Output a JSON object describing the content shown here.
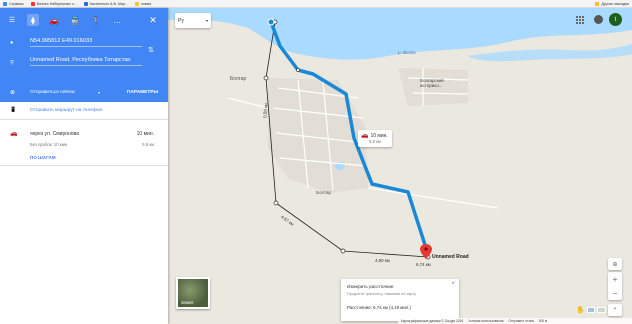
{
  "bookmarks": {
    "items": [
      {
        "label": "Сервисы",
        "color": "#4285f4"
      },
      {
        "label": "Бизнес Набережных с...",
        "color": "#e53935"
      },
      {
        "label": "Касательно А.В. Мар...",
        "color": "#1976d2"
      },
      {
        "label": "новые",
        "color": "#fbc02d"
      }
    ],
    "other": "Другие закладки"
  },
  "directions": {
    "origin": "N54.995812 E49.016033",
    "destination": "Unnamed Road, Республика Татарстан",
    "depart_label": "Отправиться сейчас",
    "options_label": "ПАРАМЕТРЫ",
    "send_label": "Отправить маршрут на телефон"
  },
  "route": {
    "via": "через ул. Смиронова",
    "time": "10 мин.",
    "traffic": "Без пробок: 10 мин.",
    "distance": "5,9 км",
    "steps_link": "ПО ШАГАМ"
  },
  "map": {
    "search_lang": "Ру",
    "callout_time": "10 мин.",
    "callout_dist": "5,9 км",
    "dest_label": "Unnamed Road",
    "place_bogatar": "Болтар",
    "place_bogatar_historic": "Болгарский\nисторико...",
    "place_bolgar2": "Болгар",
    "river_label": "р. Волга",
    "street_labels": [
      "ул. Ленина",
      "ул. Пионерская",
      "ул. Гагарина",
      "ул. Советская",
      "ул. Кооперативная",
      "ул. Заводская"
    ],
    "segment_labels": [
      "0,59 км",
      "0,97 км",
      "4,67 км",
      "4,90 км",
      "6,74 км"
    ],
    "user_initial": "t"
  },
  "measure": {
    "title": "Измерить расстояние",
    "hint": "Продлите трансекту, нажимая на карту",
    "total": "Расстояние: 6,74 км (4,19 мил.)"
  },
  "bottom": {
    "copyright": "Картографические данные © Google 2016",
    "terms": "Условия использования",
    "feedback": "Отправить отзыв",
    "scale": "500 м"
  },
  "satellite_label": "Земля"
}
